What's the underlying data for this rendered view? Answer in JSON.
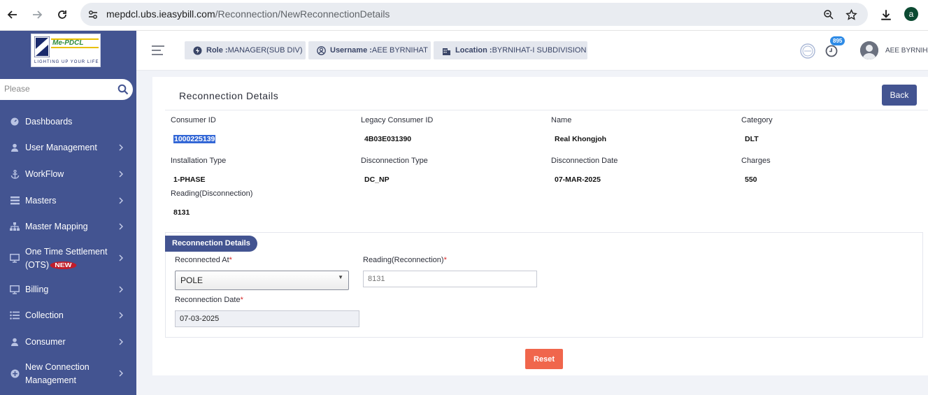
{
  "browser": {
    "url_host": "mepdcl.ubs.ieasybill.com",
    "url_path": "/Reconnection/NewReconnectionDetails",
    "profile_initial": "a"
  },
  "logo": {
    "brand": "Me-PDCL",
    "tagline": "LIGHTING UP YOUR LIFE"
  },
  "sidebar": {
    "search_placeholder": "Please",
    "new_badge": "NEW",
    "items": [
      {
        "label": "Dashboards",
        "icon": "gauge-icon",
        "has_chevron": false
      },
      {
        "label": "User Management",
        "icon": "user-icon",
        "has_chevron": true
      },
      {
        "label": "WorkFlow",
        "icon": "anchor-icon",
        "has_chevron": true
      },
      {
        "label": "Masters",
        "icon": "list-icon",
        "has_chevron": true
      },
      {
        "label": "Master Mapping",
        "icon": "sitemap-icon",
        "has_chevron": true
      },
      {
        "label_line1": "One Time Settlement",
        "label_line2": "(OTS)",
        "icon": "monitor-icon",
        "has_chevron": true
      },
      {
        "label": "Billing",
        "icon": "monitor-icon",
        "has_chevron": true
      },
      {
        "label": "Collection",
        "icon": "list-icon",
        "has_chevron": true
      },
      {
        "label": "Consumer",
        "icon": "user-icon",
        "has_chevron": true
      },
      {
        "label_line1": "New Connection",
        "label_line2": "Management",
        "icon": "plus-circle-icon",
        "has_chevron": true
      }
    ]
  },
  "header": {
    "role_key": "Role :",
    "role_value": "MANAGER(SUB DIV)",
    "username_key": "Username :",
    "username_value": "AEE BYRNIHAT",
    "location_key": "Location :",
    "location_value": "BYRNIHAT-I SUBDIVISION",
    "notification_count": "895",
    "user_name": "AEE BYRNIHAT"
  },
  "panel": {
    "title": "Reconnection Details",
    "back_label": "Back",
    "fields": {
      "consumer_id": {
        "label": "Consumer ID",
        "value": "1000225139"
      },
      "legacy_consumer_id": {
        "label": "Legacy Consumer ID",
        "value": "4B03E031390"
      },
      "name": {
        "label": "Name",
        "value": "Real Khongjoh"
      },
      "category": {
        "label": "Category",
        "value": "DLT"
      },
      "installation_type": {
        "label": "Installation Type",
        "value": "1-PHASE"
      },
      "disconnection_type": {
        "label": "Disconnection Type",
        "value": "DC_NP"
      },
      "disconnection_date": {
        "label": "Disconnection Date",
        "value": "07-MAR-2025"
      },
      "charges": {
        "label": "Charges",
        "value": "550"
      },
      "reading_disconnection": {
        "label": "Reading(Disconnection)",
        "value": "8131"
      }
    },
    "reconnection": {
      "tab_label": "Reconnection Details",
      "reconnected_at_label": "Reconnected At",
      "reconnected_at_value": "POLE",
      "reading_label": "Reading(Reconnection)",
      "reading_placeholder": "8131",
      "date_label": "Reconnection Date",
      "date_value": "07-03-2025",
      "required_mark": "*"
    },
    "reset_label": "Reset"
  },
  "colors": {
    "sidebar_bg": "#435491",
    "accent": "#435491",
    "reset": "#f0664c"
  }
}
